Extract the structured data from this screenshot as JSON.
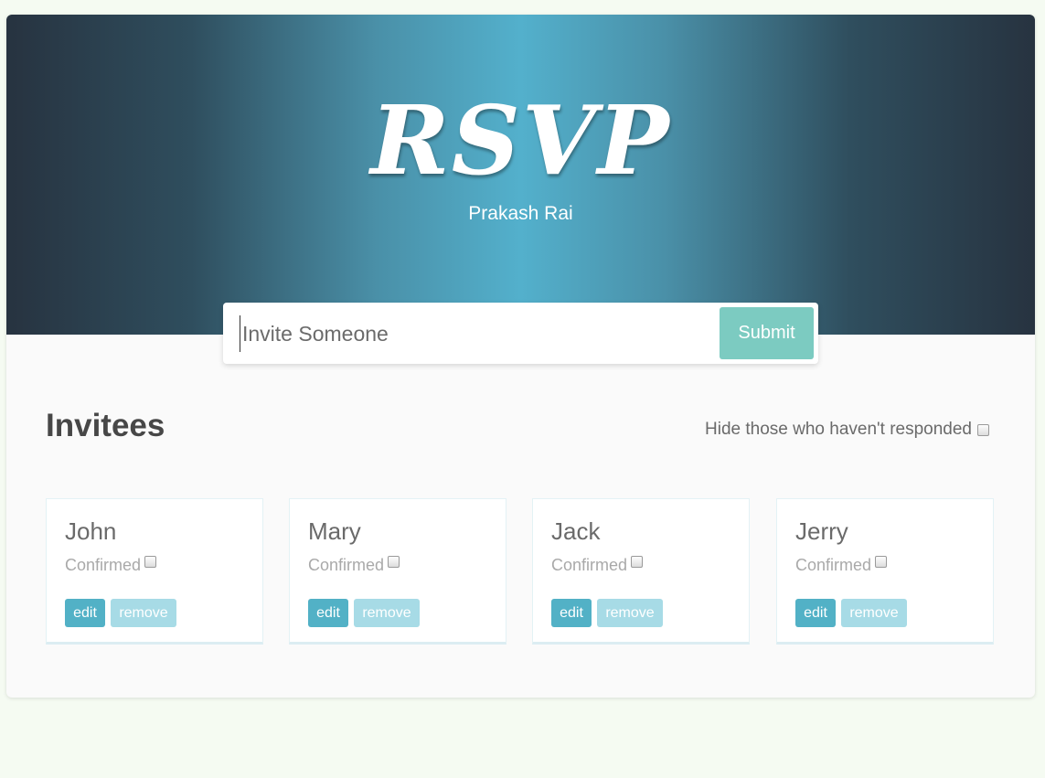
{
  "header": {
    "logo": "RSVP",
    "subtitle": "Prakash Rai"
  },
  "invite_form": {
    "placeholder": "Invite Someone",
    "value": "",
    "submit_label": "Submit"
  },
  "invitees_section": {
    "title": "Invitees",
    "filter_label": "Hide those who haven't responded",
    "filter_checked": false
  },
  "invitees": [
    {
      "name": "John",
      "status_label": "Confirmed",
      "confirmed": false,
      "edit_label": "edit",
      "remove_label": "remove"
    },
    {
      "name": "Mary",
      "status_label": "Confirmed",
      "confirmed": false,
      "edit_label": "edit",
      "remove_label": "remove"
    },
    {
      "name": "Jack",
      "status_label": "Confirmed",
      "confirmed": false,
      "edit_label": "edit",
      "remove_label": "remove"
    },
    {
      "name": "Jerry",
      "status_label": "Confirmed",
      "confirmed": false,
      "edit_label": "edit",
      "remove_label": "remove"
    }
  ],
  "colors": {
    "page_background": "#f5fbf2",
    "header_center": "#53b0cc",
    "header_edge": "#273340",
    "submit_button": "#7ccbc1",
    "edit_button": "#52b1c6",
    "remove_button": "#a7dbe6"
  }
}
